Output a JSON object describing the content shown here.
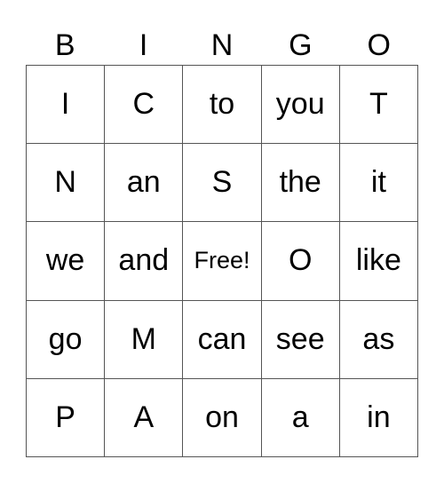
{
  "header": [
    "B",
    "I",
    "N",
    "G",
    "O"
  ],
  "rows": [
    [
      "I",
      "C",
      "to",
      "you",
      "T"
    ],
    [
      "N",
      "an",
      "S",
      "the",
      "it"
    ],
    [
      "we",
      "and",
      "Free!",
      "O",
      "like"
    ],
    [
      "go",
      "M",
      "can",
      "see",
      "as"
    ],
    [
      "P",
      "A",
      "on",
      "a",
      "in"
    ]
  ]
}
